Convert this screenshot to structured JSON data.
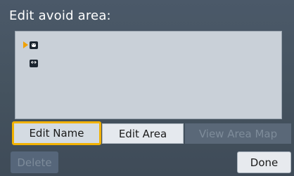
{
  "screen": {
    "title": "Edit avoid area:"
  },
  "list": {
    "items": [
      {
        "icon": "face-icon",
        "selected": true,
        "label": ""
      },
      {
        "icon": "left-right-arrows-icon",
        "selected": false,
        "label": ""
      }
    ]
  },
  "buttons": {
    "edit_name": "Edit Name",
    "edit_area": "Edit Area",
    "view_area_map": "View Area Map",
    "delete": "Delete",
    "done": "Done"
  },
  "colors": {
    "background": "#45535f",
    "focus_border": "#f2b200",
    "cursor": "#f0a000",
    "disabled_text": "#7e8c9a"
  }
}
